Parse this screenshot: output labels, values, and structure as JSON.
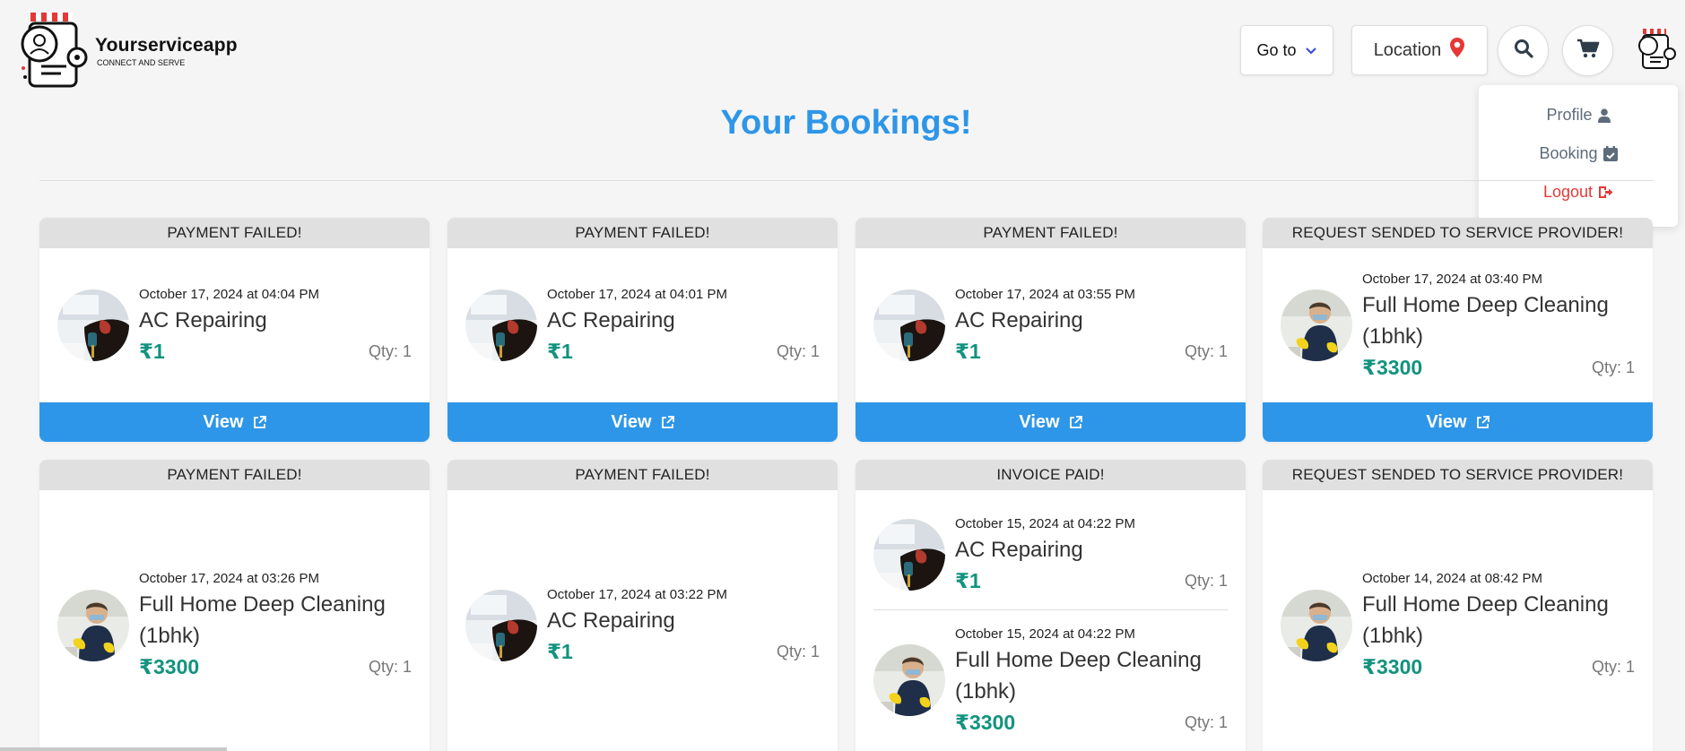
{
  "brand": {
    "name": "Yourserviceapp",
    "tagline": "CONNECT AND SERVE"
  },
  "nav": {
    "goto_label": "Go to",
    "location_label": "Location"
  },
  "menu": {
    "profile": "Profile",
    "booking": "Booking",
    "logout": "Logout"
  },
  "page_title": "Your Bookings!",
  "view_label": "View",
  "colors": {
    "primary": "#2e96e8",
    "price": "#12937f",
    "logout": "#e53935"
  },
  "bookings": [
    {
      "status": "PAYMENT FAILED!",
      "items": [
        {
          "date": "October 17, 2024 at 04:04 PM",
          "name": "AC Repairing",
          "price": "₹1",
          "qty": "Qty: 1",
          "thumb": "ac"
        }
      ]
    },
    {
      "status": "PAYMENT FAILED!",
      "items": [
        {
          "date": "October 17, 2024 at 04:01 PM",
          "name": "AC Repairing",
          "price": "₹1",
          "qty": "Qty: 1",
          "thumb": "ac"
        }
      ]
    },
    {
      "status": "PAYMENT FAILED!",
      "items": [
        {
          "date": "October 17, 2024 at 03:55 PM",
          "name": "AC Repairing",
          "price": "₹1",
          "qty": "Qty: 1",
          "thumb": "ac"
        }
      ]
    },
    {
      "status": "REQUEST SENDED TO SERVICE PROVIDER!",
      "items": [
        {
          "date": "October 17, 2024 at 03:40 PM",
          "name": "Full Home Deep Cleaning (1bhk)",
          "price": "₹3300",
          "qty": "Qty: 1",
          "thumb": "clean"
        }
      ]
    },
    {
      "status": "PAYMENT FAILED!",
      "items": [
        {
          "date": "October 17, 2024 at 03:26 PM",
          "name": "Full Home Deep Cleaning (1bhk)",
          "price": "₹3300",
          "qty": "Qty: 1",
          "thumb": "clean"
        }
      ]
    },
    {
      "status": "PAYMENT FAILED!",
      "items": [
        {
          "date": "October 17, 2024 at 03:22 PM",
          "name": "AC Repairing",
          "price": "₹1",
          "qty": "Qty: 1",
          "thumb": "ac"
        }
      ]
    },
    {
      "status": "INVOICE PAID!",
      "items": [
        {
          "date": "October 15, 2024 at 04:22 PM",
          "name": "AC Repairing",
          "price": "₹1",
          "qty": "Qty: 1",
          "thumb": "ac"
        },
        {
          "date": "October 15, 2024 at 04:22 PM",
          "name": "Full Home Deep Cleaning (1bhk)",
          "price": "₹3300",
          "qty": "Qty: 1",
          "thumb": "clean"
        }
      ]
    },
    {
      "status": "REQUEST SENDED TO SERVICE PROVIDER!",
      "items": [
        {
          "date": "October 14, 2024 at 08:42 PM",
          "name": "Full Home Deep Cleaning (1bhk)",
          "price": "₹3300",
          "qty": "Qty: 1",
          "thumb": "clean"
        }
      ]
    }
  ]
}
